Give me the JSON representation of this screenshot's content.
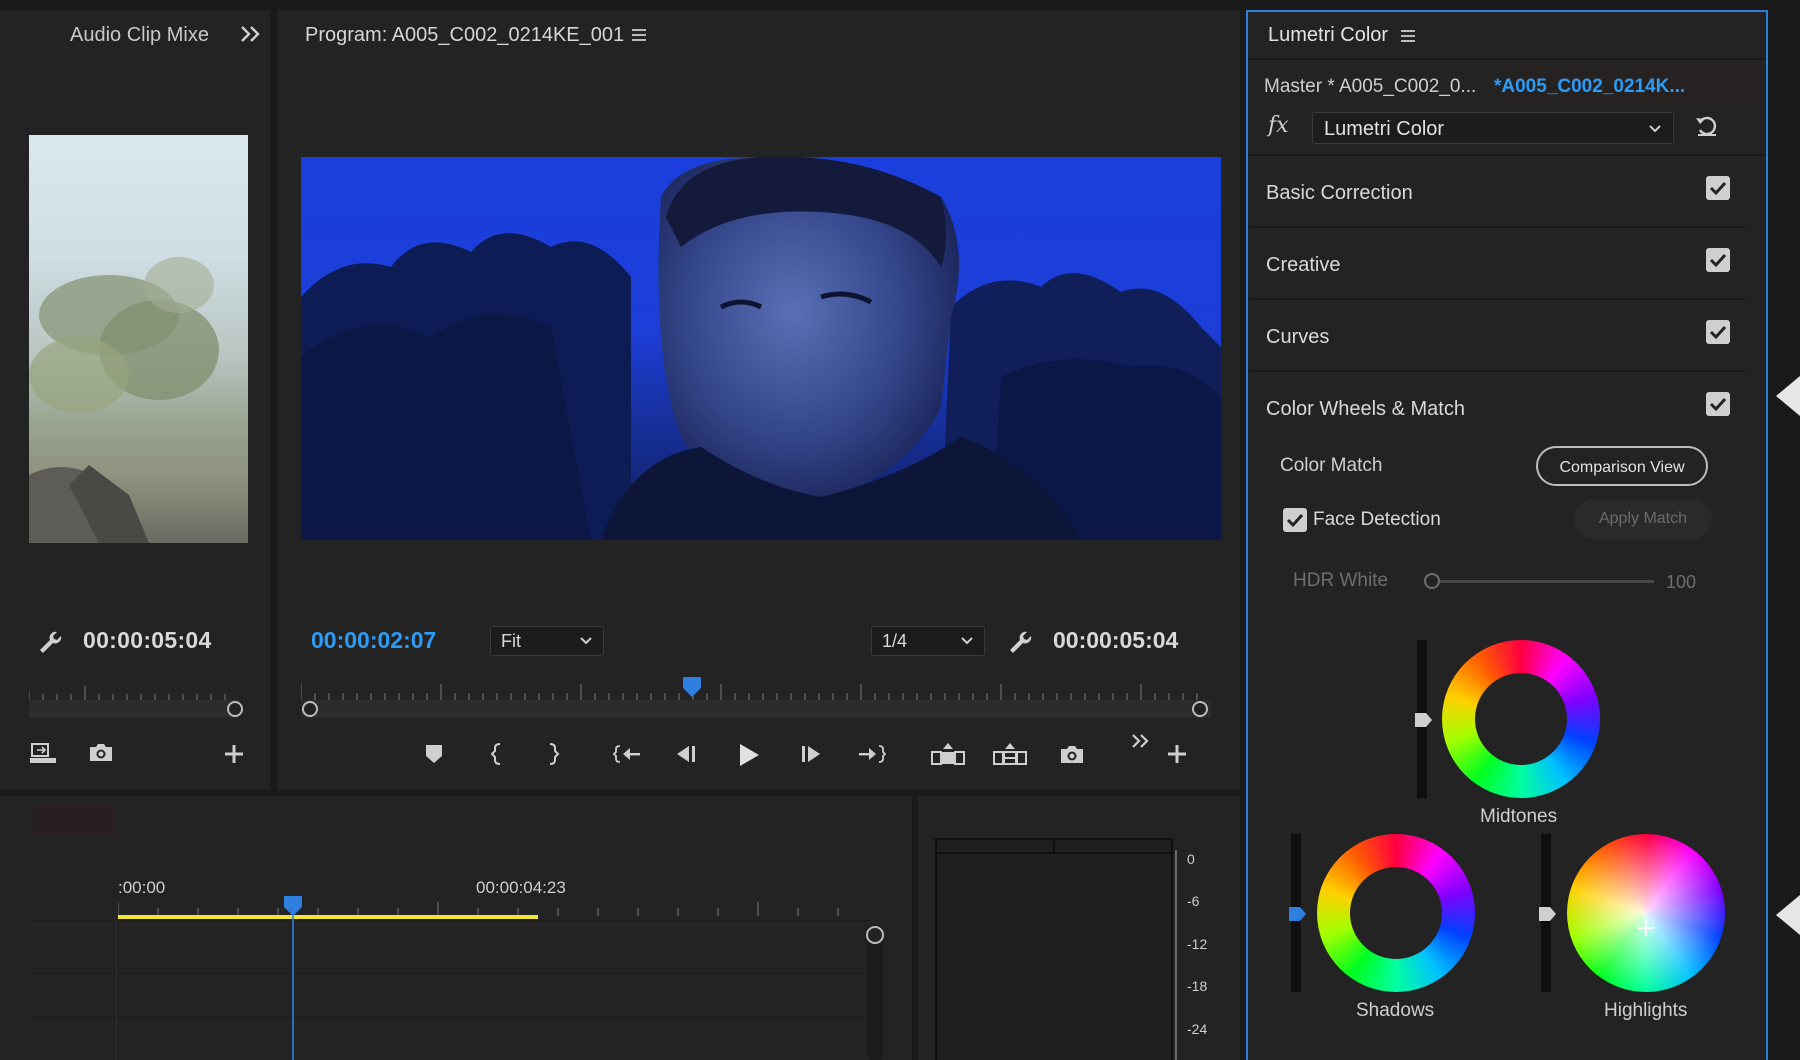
{
  "left_panel": {
    "title": "Audio Clip Mixe",
    "timecode": "00:00:05:04"
  },
  "program_monitor": {
    "title": "Program: A005_C002_0214KE_001",
    "current_time": "00:00:02:07",
    "duration": "00:00:05:04",
    "zoom_select": "Fit",
    "resolution_select": "1/4",
    "playhead_fraction": 0.43
  },
  "timeline": {
    "time_start": ":00:00",
    "time_mark": "00:00:04:23",
    "playhead_fraction": 0.23
  },
  "audio_meter": {
    "scale": [
      "0",
      "-6",
      "-12",
      "-18",
      "-24"
    ]
  },
  "lumetri": {
    "title": "Lumetri Color",
    "master_label": "Master * A005_C002_0...",
    "clip_label": "*A005_C002_0214K...",
    "fx_label": "fx",
    "effect_select": "Lumetri Color",
    "sections": [
      {
        "label": "Basic Correction",
        "checked": true
      },
      {
        "label": "Creative",
        "checked": true
      },
      {
        "label": "Curves",
        "checked": true
      },
      {
        "label": "Color Wheels & Match",
        "checked": true
      }
    ],
    "color_match_label": "Color Match",
    "comparison_view_button": "Comparison View",
    "face_detection_label": "Face Detection",
    "apply_match_button": "Apply Match",
    "hdr_white_label": "HDR White",
    "hdr_white_value": "100",
    "wheels": {
      "midtones": "Midtones",
      "shadows": "Shadows",
      "highlights": "Highlights"
    }
  },
  "colors": {
    "accent_blue": "#2e9bf5",
    "panel_border": "#2d7fd8",
    "timeline_yellow": "#f2e23a"
  }
}
